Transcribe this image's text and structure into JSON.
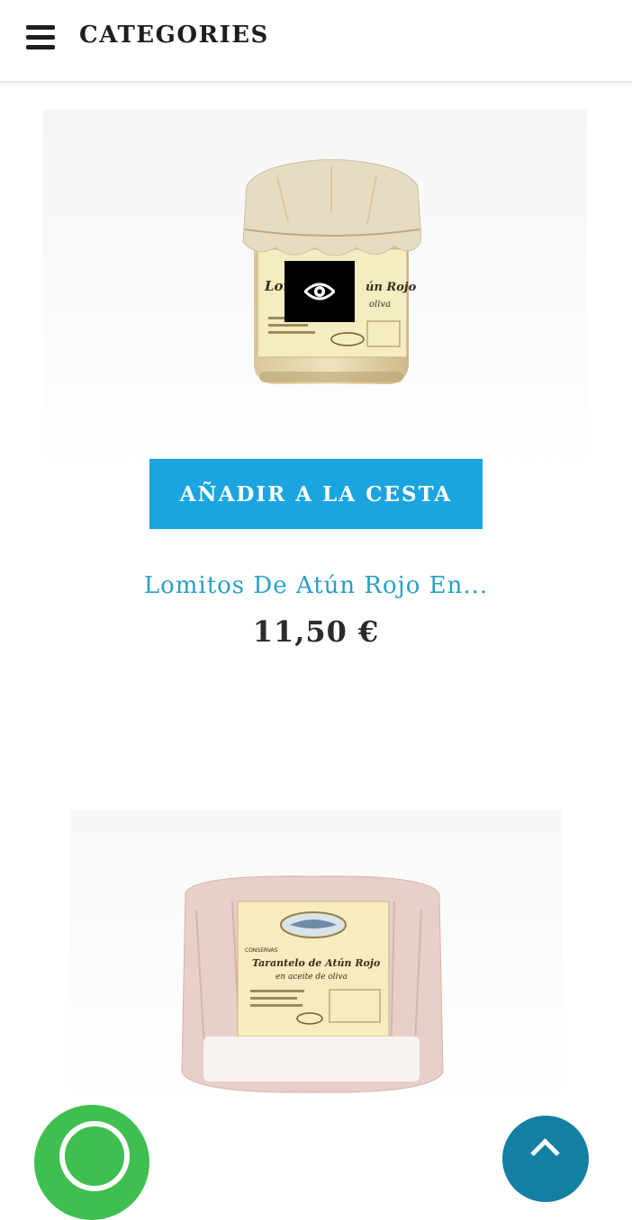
{
  "header": {
    "menu_icon": "hamburger-menu-icon",
    "title": "CATEGORIES"
  },
  "products": [
    {
      "name": "Lomitos De Atún Rojo En...",
      "price": "11,50 €",
      "add_to_cart_label": "AÑADIR A LA CESTA",
      "quick_view_icon": "eye-icon",
      "image_label": {
        "line1": "Lomi",
        "line2": "ún Rojo",
        "line3": "oliva"
      }
    },
    {
      "image_label": {
        "brand": "CONSERVAS",
        "line1": "Tarantelo de Atún Rojo",
        "line2": "en aceite de oliva"
      }
    }
  ],
  "floating": {
    "whatsapp_icon": "whatsapp-icon",
    "scroll_icon": "chevron-up-icon"
  },
  "colors": {
    "accent": "#1aa5e0",
    "product_link": "#2a9fc6",
    "whatsapp": "#3fbf4f",
    "scroll": "#137fa3"
  }
}
